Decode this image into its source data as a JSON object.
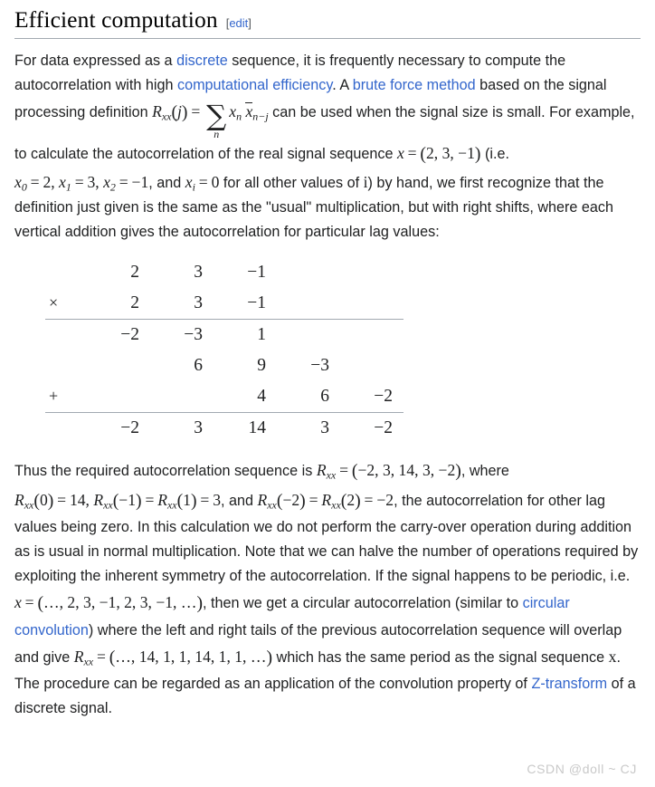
{
  "heading": {
    "title": "Efficient computation",
    "edit_open_bracket": "[",
    "edit_label": "edit",
    "edit_close_bracket": "]"
  },
  "paragraph1": {
    "t1": "For data expressed as a ",
    "link_discrete": "discrete",
    "t2": " sequence, it is frequently necessary to compute the autocorrelation with high ",
    "link_comp_eff": "computational efficiency",
    "t3": ". A ",
    "link_brute": "brute force method",
    "t4": " based on the signal processing definition ",
    "formula": {
      "R": "R",
      "R_sub": "xx",
      "arg_open": "(",
      "arg_var": "j",
      "arg_close": ")",
      "equals": "=",
      "sigma": "∑",
      "sigma_limit": "n",
      "term1_var": "x",
      "term1_sub": "n",
      "term2_var": "x",
      "term2_sub": "n−j"
    },
    "t5": " can be used when the signal size is small. For example, to calculate the autocorrelation of the real signal sequence ",
    "seq_x": "x",
    "seq_eq": "=",
    "seq_open": "(",
    "seq_vals": "2, 3, −1",
    "seq_close": ")",
    "t6": " (i.e. ",
    "x0": "x",
    "x0_sub": "0",
    "x0_eq": "=",
    "x0_val": "2",
    "c1": ", ",
    "x1": "x",
    "x1_sub": "1",
    "x1_eq": "=",
    "x1_val": "3",
    "c2": ", ",
    "x2": "x",
    "x2_sub": "2",
    "x2_eq": "=",
    "x2_val": "−1",
    "t7": ", and ",
    "xi": "x",
    "xi_sub": "i",
    "xi_eq": "=",
    "xi_val": "0",
    "t8": " for all other values of ",
    "i_italic": "i",
    "t9": ") by hand, we first recognize that the definition just given is the same as the \"usual\" multiplication, but with right shifts, where each vertical addition gives the autocorrelation for particular lag values:"
  },
  "multiplication": {
    "rows": [
      {
        "op": "",
        "cells": [
          "",
          "2",
          "3",
          "−1",
          "",
          ""
        ],
        "rule_above": false
      },
      {
        "op": "×",
        "cells": [
          "",
          "2",
          "3",
          "−1",
          "",
          ""
        ],
        "rule_above": false
      },
      {
        "op": "",
        "cells": [
          "",
          "−2",
          "−3",
          "1",
          "",
          ""
        ],
        "rule_above": true
      },
      {
        "op": "",
        "cells": [
          "",
          "",
          "6",
          "9",
          "−3",
          ""
        ],
        "rule_above": false
      },
      {
        "op": "+",
        "cells": [
          "",
          "",
          "",
          "4",
          "6",
          "−2"
        ],
        "rule_above": false
      },
      {
        "op": "",
        "cells": [
          "",
          "−2",
          "3",
          "14",
          "3",
          "−2"
        ],
        "rule_above": true
      }
    ]
  },
  "paragraph2": {
    "t1": "Thus the required autocorrelation sequence is ",
    "Rxx": "R",
    "Rxx_sub": "xx",
    "Rxx_eq": "=",
    "Rxx_open": "(",
    "Rxx_vals": "−2, 3, 14, 3, −2",
    "Rxx_close": ")",
    "t2": ", where ",
    "r0": "R",
    "r0_sub": "xx",
    "r0_open": "(",
    "r0_arg": "0",
    "r0_close": ")",
    "r0_eq": "=",
    "r0_val": "14",
    "t3": ", ",
    "rm1": "R",
    "rm1_sub": "xx",
    "rm1_open": "(",
    "rm1_arg": "−1",
    "rm1_close": ")",
    "rm1_eq": "=",
    "rp1": "R",
    "rp1_sub": "xx",
    "rp1_open": "(",
    "rp1_arg": "1",
    "rp1_close": ")",
    "rp1_eq": "=",
    "rp1_val": "3",
    "t4": ", and ",
    "rm2": "R",
    "rm2_sub": "xx",
    "rm2_open": "(",
    "rm2_arg": "−2",
    "rm2_close": ")",
    "rm2_eq": "=",
    "rp2": "R",
    "rp2_sub": "xx",
    "rp2_open": "(",
    "rp2_arg": "2",
    "rp2_close": ")",
    "rp2_eq": "=",
    "rp2_val": "−2",
    "t5": ", the autocorrelation for other lag values being zero. In this calculation we do not perform the carry-over operation during addition as is usual in normal multiplication. Note that we can halve the number of operations required by exploiting the inherent symmetry of the autocorrelation. If the signal happens to be periodic, i.e. ",
    "px": "x",
    "px_eq": "=",
    "px_open": "(",
    "px_vals": "…, 2, 3, −1, 2, 3, −1, …",
    "px_close": ")",
    "t6": ", then we get a circular autocorrelation (similar to ",
    "link_circ_conv": "circular convolution",
    "t7": ") where the left and right tails of the previous autocorrelation sequence will overlap and give ",
    "cr": "R",
    "cr_sub": "xx",
    "cr_eq": "=",
    "cr_open": "(",
    "cr_vals": "…, 14, 1, 1, 14, 1, 1, …",
    "cr_close": ")",
    "t8": " which has the same period as the signal sequence ",
    "sx": "x",
    "t9": ". The procedure can be regarded as an application of the convolution property of ",
    "link_ztransform": "Z-transform",
    "t10": " of a discrete signal."
  },
  "watermark": {
    "text": "CSDN @doll ~ CJ"
  },
  "colors": {
    "link": "#3366cc",
    "text": "#202122",
    "rule": "#a2a9b1",
    "watermark": "#c9c9c9",
    "background": "#ffffff"
  }
}
